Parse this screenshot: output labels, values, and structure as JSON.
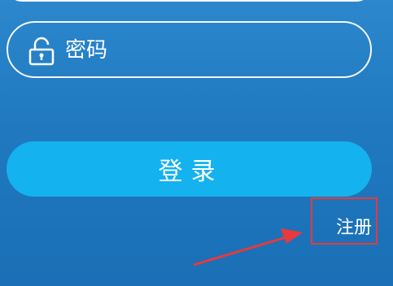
{
  "form": {
    "password_placeholder": "密码",
    "login_label": "登录",
    "register_label": "注册"
  },
  "icons": {
    "lock": "lock-icon"
  },
  "colors": {
    "background_top": "#2c87cc",
    "background_bottom": "#1a6fb5",
    "login_button": "#14b2ef",
    "field_border": "#ffffff",
    "annotation": "#e8393d"
  }
}
